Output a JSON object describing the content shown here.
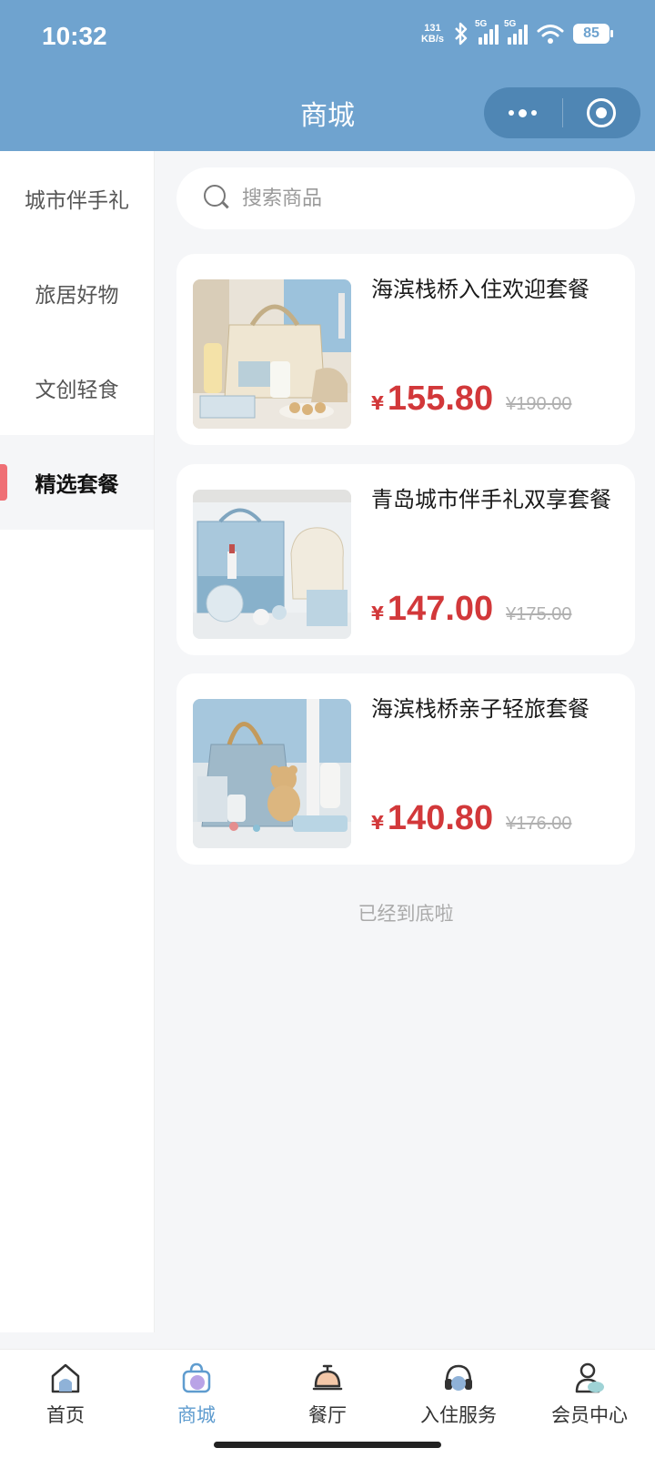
{
  "status_bar": {
    "time": "10:32",
    "net_speed_value": "131",
    "net_speed_unit": "KB/s",
    "sim1_tag": "5G",
    "sim2_tag": "5G",
    "battery": "85"
  },
  "header": {
    "title": "商城"
  },
  "sidebar": {
    "items": [
      {
        "label": "城市伴手礼",
        "active": false
      },
      {
        "label": "旅居好物",
        "active": false
      },
      {
        "label": "文创轻食",
        "active": false
      },
      {
        "label": "精选套餐",
        "active": true
      }
    ]
  },
  "search": {
    "placeholder": "搜索商品"
  },
  "products": [
    {
      "name": "海滨栈桥入住欢迎套餐",
      "currency": "¥",
      "price": "155.80",
      "original_price": "¥190.00"
    },
    {
      "name": "青岛城市伴手礼双享套餐",
      "currency": "¥",
      "price": "147.00",
      "original_price": "¥175.00"
    },
    {
      "name": "海滨栈桥亲子轻旅套餐",
      "currency": "¥",
      "price": "140.80",
      "original_price": "¥176.00"
    }
  ],
  "list_end_text": "已经到底啦",
  "tabbar": {
    "tabs": [
      {
        "label": "首页",
        "icon": "home-icon",
        "active": false
      },
      {
        "label": "商城",
        "icon": "shopping-bag-icon",
        "active": true
      },
      {
        "label": "餐厅",
        "icon": "service-bell-icon",
        "active": false
      },
      {
        "label": "入住服务",
        "icon": "headset-icon",
        "active": false
      },
      {
        "label": "会员中心",
        "icon": "member-icon",
        "active": false
      }
    ]
  },
  "colors": {
    "header_bg": "#6fa3cf",
    "price_red": "#d2383a",
    "active_tab": "#5f9ccf",
    "sidebar_indicator": "#ef6f75"
  }
}
